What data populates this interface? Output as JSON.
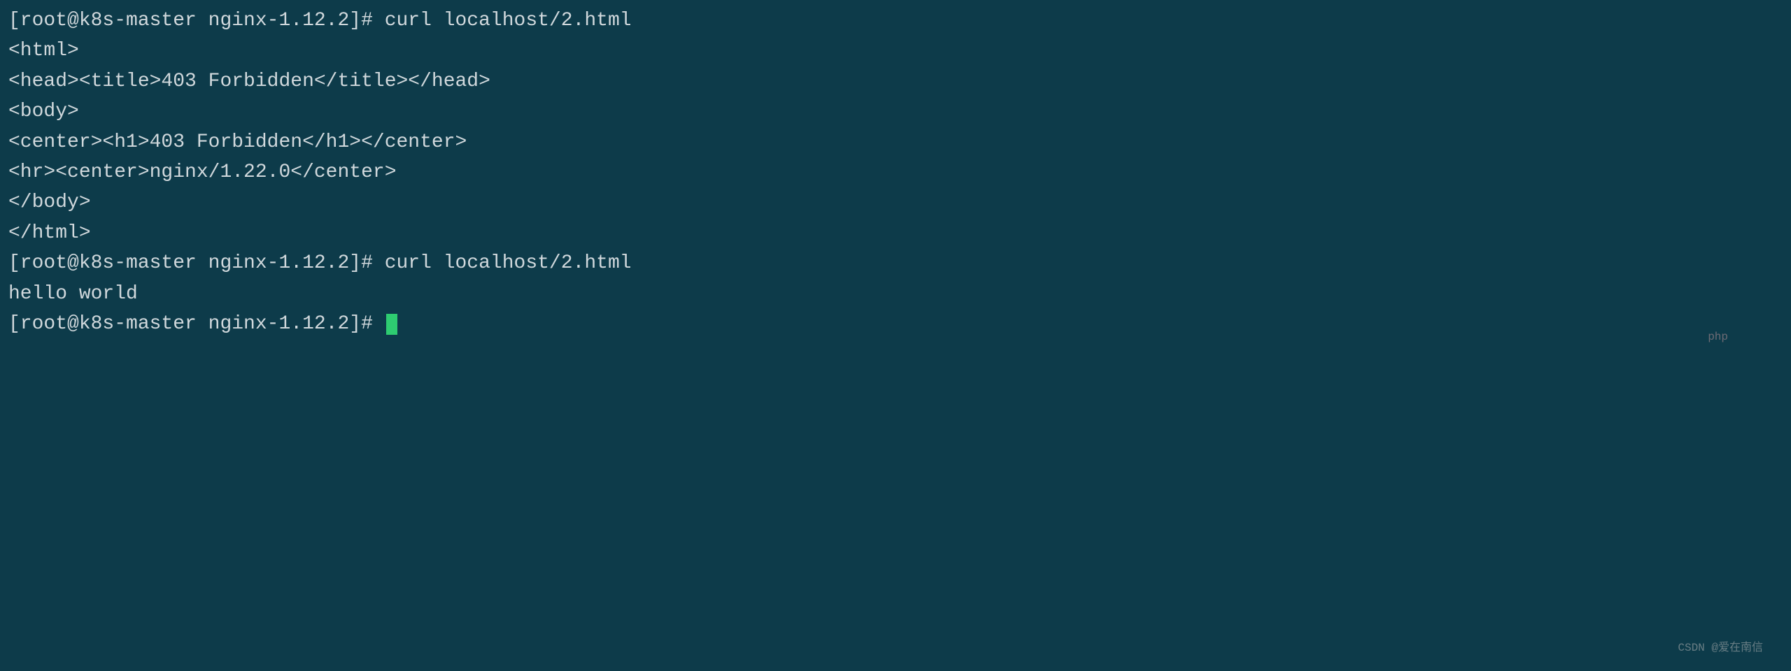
{
  "colors": {
    "background": "#0d3b4a",
    "text": "#d0d8dc",
    "cursor": "#2ecc71"
  },
  "lines": [
    {
      "prompt": "[root@k8s-master nginx-1.12.2]# ",
      "command": "curl localhost/2.html"
    },
    {
      "output": "<html>"
    },
    {
      "output": "<head><title>403 Forbidden</title></head>"
    },
    {
      "output": "<body>"
    },
    {
      "output": "<center><h1>403 Forbidden</h1></center>"
    },
    {
      "output": "<hr><center>nginx/1.22.0</center>"
    },
    {
      "output": "</body>"
    },
    {
      "output": "</html>"
    },
    {
      "prompt": "[root@k8s-master nginx-1.12.2]# ",
      "command": "curl localhost/2.html"
    },
    {
      "output": "hello world"
    },
    {
      "prompt": "[root@k8s-master nginx-1.12.2]# ",
      "cursor": true
    }
  ],
  "watermarks": {
    "w1": "php",
    "w2": "CSDN @爱在南信"
  }
}
